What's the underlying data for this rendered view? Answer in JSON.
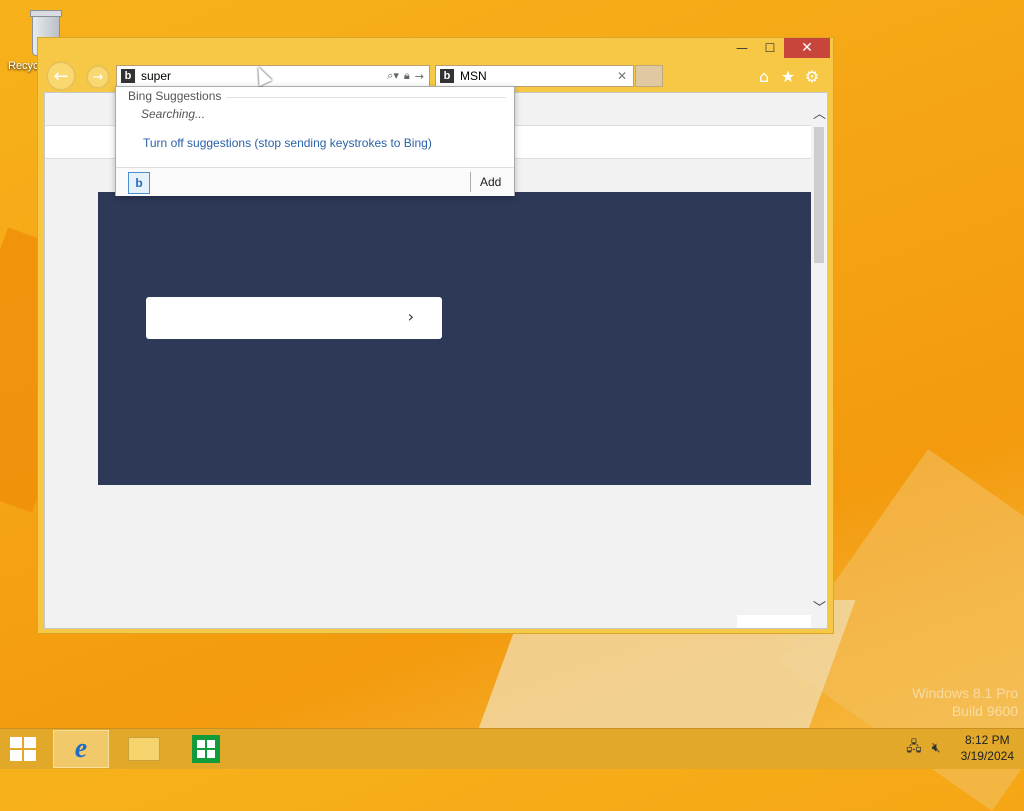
{
  "desktop": {
    "recycle_bin_label": "Recyc",
    "watermark_line1": "Windows 8.1 Pro",
    "watermark_line2": "Build 9600"
  },
  "browser": {
    "window_controls": {
      "minimize": "—",
      "maximize": "☐",
      "close": "✕"
    },
    "address_bar": {
      "value": "super"
    },
    "tab": {
      "title": "MSN"
    },
    "suggestions": {
      "header": "Bing Suggestions",
      "status": "Searching...",
      "turn_off_link": "Turn off suggestions (stop sending keystrokes to Bing)",
      "add_button": "Add"
    }
  },
  "taskbar": {
    "clock_time": "8:12 PM",
    "clock_date": "3/19/2024"
  },
  "icons": [
    "recycle-bin-icon",
    "back-arrow-icon",
    "forward-arrow-icon",
    "bing-icon",
    "search-icon",
    "lock-icon",
    "go-arrow-icon",
    "close-icon",
    "home-icon",
    "favorites-star-icon",
    "settings-gear-icon",
    "chevron-right-icon",
    "scroll-up-icon",
    "scroll-down-icon",
    "windows-start-icon",
    "internet-explorer-icon",
    "file-explorer-icon",
    "store-icon",
    "network-icon",
    "volume-muted-icon"
  ],
  "colors": {
    "window_frame": "#f6c845",
    "close_button": "#c7453a",
    "hero_bg": "#2d3957",
    "link": "#2a62a8",
    "taskbar": "#e2a82a"
  }
}
